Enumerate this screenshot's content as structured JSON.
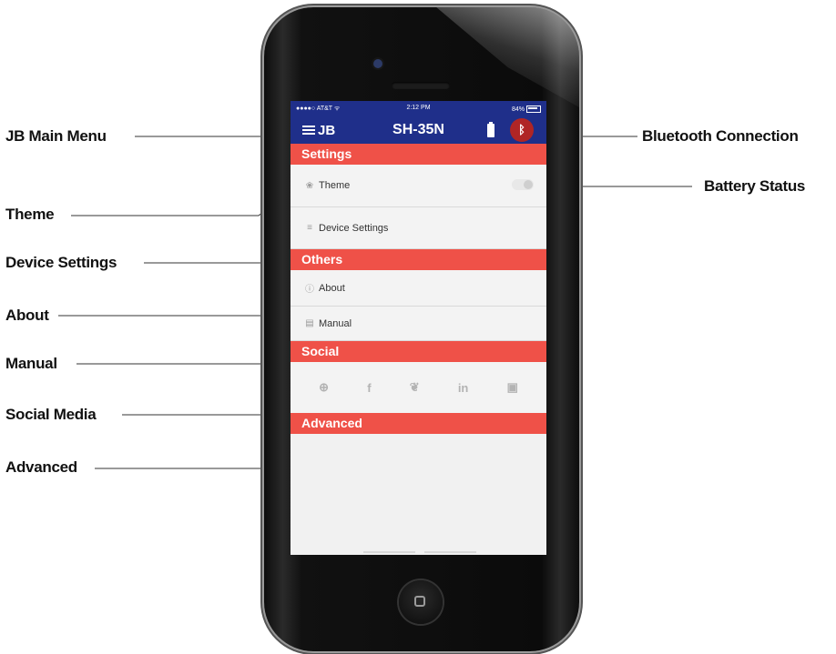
{
  "callouts": {
    "jb_main_menu": "JB Main Menu",
    "theme": "Theme",
    "device_settings": "Device Settings",
    "about": "About",
    "manual": "Manual",
    "social_media": "Social Media",
    "advanced": "Advanced",
    "bluetooth_connection": "Bluetooth Connection",
    "battery_status": "Battery Status"
  },
  "status_bar": {
    "carrier": "●●●●○ AT&T ᯤ",
    "time": "2:12 PM",
    "battery": "84%"
  },
  "nav": {
    "menu_label": "JB",
    "title": "SH-35N",
    "battery_icon": "battery-icon",
    "bluetooth_icon": "bluetooth-icon"
  },
  "sections": {
    "settings": "Settings",
    "others": "Others",
    "social": "Social",
    "advanced": "Advanced"
  },
  "rows": {
    "theme": "Theme",
    "device_settings": "Device Settings",
    "about": "About",
    "manual": "Manual"
  },
  "social_icons": [
    "globe-icon",
    "facebook-icon",
    "twitter-icon",
    "linkedin-icon",
    "youtube-icon"
  ],
  "colors": {
    "nav_blue": "#1f2f8a",
    "section_red": "#ef5148",
    "bluetooth_red": "#b02525"
  }
}
